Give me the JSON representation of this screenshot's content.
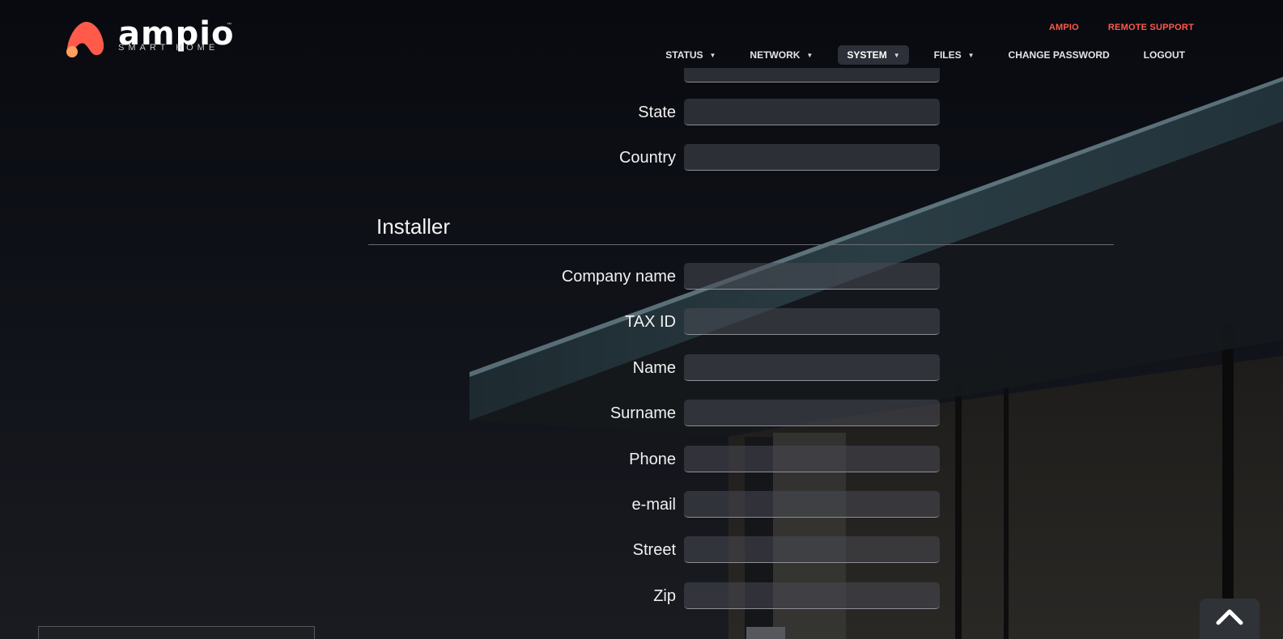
{
  "brand": {
    "name": "ampio",
    "tagline": "SMART HOME",
    "trademark": "™",
    "logo_icon": "ampio-logo-icon",
    "accent_color": "#ff5a4a"
  },
  "top_links": [
    {
      "label": "AMPIO"
    },
    {
      "label": "REMOTE SUPPORT"
    }
  ],
  "nav": [
    {
      "label": "STATUS",
      "dropdown": true,
      "active": false
    },
    {
      "label": "NETWORK",
      "dropdown": true,
      "active": false
    },
    {
      "label": "SYSTEM",
      "dropdown": true,
      "active": true
    },
    {
      "label": "FILES",
      "dropdown": true,
      "active": false
    },
    {
      "label": "CHANGE PASSWORD",
      "dropdown": false,
      "active": false
    },
    {
      "label": "LOGOUT",
      "dropdown": false,
      "active": false
    }
  ],
  "address_fields": [
    {
      "label": "State",
      "value": ""
    },
    {
      "label": "Country",
      "value": ""
    }
  ],
  "installer": {
    "title": "Installer",
    "fields": [
      {
        "label": "Company name",
        "value": ""
      },
      {
        "label": "TAX ID",
        "value": ""
      },
      {
        "label": "Name",
        "value": ""
      },
      {
        "label": "Surname",
        "value": ""
      },
      {
        "label": "Phone",
        "value": ""
      },
      {
        "label": "e-mail",
        "value": ""
      },
      {
        "label": "Street",
        "value": ""
      },
      {
        "label": "Zip",
        "value": ""
      }
    ]
  },
  "scroll_top_icon": "chevron-up-icon"
}
